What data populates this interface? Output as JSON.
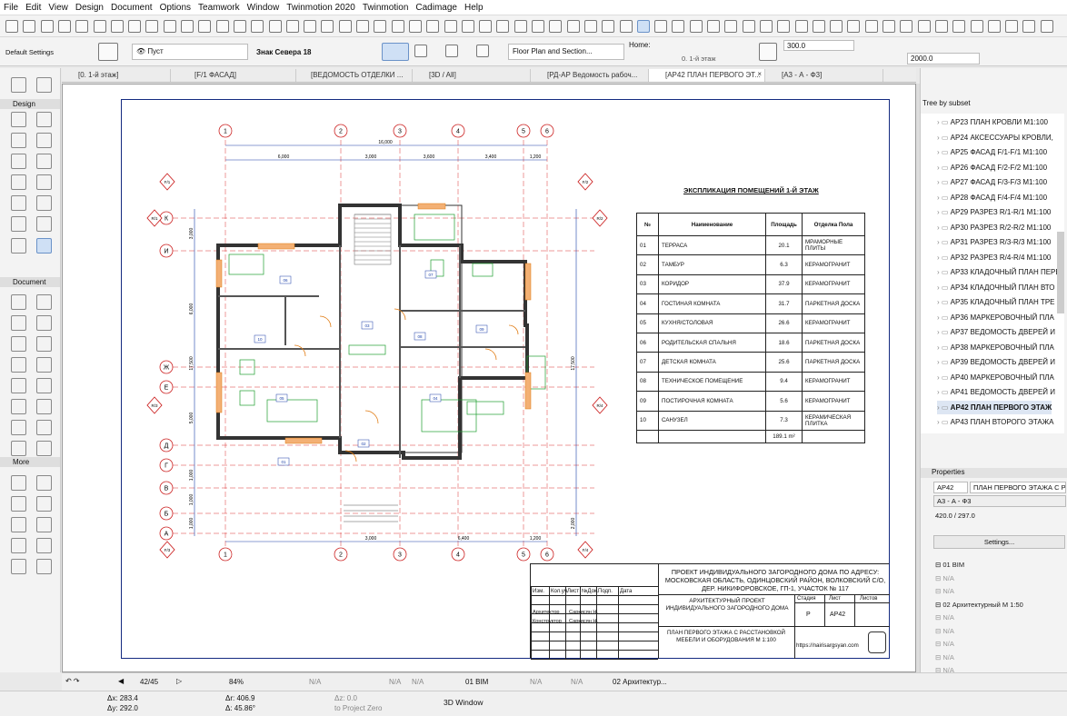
{
  "menu": [
    "File",
    "Edit",
    "View",
    "Design",
    "Document",
    "Options",
    "Teamwork",
    "Window",
    "Twinmotion 2020",
    "Twinmotion",
    "Cadimage",
    "Help"
  ],
  "info_box": {
    "settings": "Default Settings",
    "layer": "Пуст",
    "marker": "Знак Севера 18",
    "view_type": "Floor Plan and Section...",
    "home_label": "Home:",
    "home_story": "0. 1-й этаж",
    "val1": "300.0",
    "val2": "2000.0"
  },
  "tabs": [
    {
      "label": "[0. 1-й этаж]"
    },
    {
      "label": "[F/1 ФАСАД]"
    },
    {
      "label": "[ВЕДОМОСТЬ ОТДЕЛКИ ..."
    },
    {
      "label": "[3D / All]"
    },
    {
      "label": "[РД-АР Ведомость рабоч..."
    },
    {
      "label": "[АР42 ПЛАН ПЕРВОГО ЭТ..."
    },
    {
      "label": "[А3 - А - Ф3]"
    }
  ],
  "toolbox": {
    "design": "Design",
    "document": "Document",
    "more": "More"
  },
  "tree": {
    "title": "Tree by subset",
    "items": [
      "АР23 ПЛАН КРОВЛИ М1:100",
      "АР24 АКСЕССУАРЫ КРОВЛИ,",
      "АР25 ФАСАД F/1-F/1 М1:100",
      "АР26 ФАСАД F/2-F/2 М1:100",
      "АР27 ФАСАД F/3-F/3 М1:100",
      "АР28 ФАСАД F/4-F/4 М1:100",
      "АР29 РАЗРЕЗ R/1-R/1 М1:100",
      "АР30 РАЗРЕЗ R/2-R/2 М1:100",
      "АР31 РАЗРЕЗ R/3-R/3 М1:100",
      "АР32 РАЗРЕЗ R/4-R/4 М1:100",
      "АР33 КЛАДОЧНЫЙ ПЛАН ПЕРВ",
      "АР34 КЛАДОЧНЫЙ ПЛАН ВТО",
      "АР35 КЛАДОЧНЫЙ ПЛАН ТРЕ",
      "АР36 МАРКЕРОВОЧНЫЙ ПЛА",
      "АР37 ВЕДОМОСТЬ ДВЕРЕЙ И",
      "АР38 МАРКЕРОВОЧНЫЙ ПЛА",
      "АР39 ВЕДОМОСТЬ ДВЕРЕЙ И",
      "АР40 МАРКЕРОВОЧНЫЙ ПЛА",
      "АР41 ВЕДОМОСТЬ ДВЕРЕЙ И",
      "АР42 ПЛАН ПЕРВОГО ЭТАЖ",
      "АР43 ПЛАН ВТОРОГО ЭТАЖА"
    ]
  },
  "properties": {
    "title": "Properties",
    "id": "АР42",
    "name": "ПЛАН ПЕРВОГО ЭТАЖА С РАС",
    "master": "А3 - А - Ф3",
    "size": "420.0 / 297.0",
    "settings_btn": "Settings...",
    "rows": [
      "01 BIM",
      "N/A",
      "N/A",
      "02 Архитектурный М 1:50",
      "N/A",
      "N/A",
      "N/A",
      "N/A",
      "N/A",
      "N/A",
      "84%",
      "N/A"
    ]
  },
  "schedule": {
    "title": "ЭКСПЛИКАЦИЯ ПОМЕЩЕНИЙ 1-Й ЭТАЖ",
    "headers": [
      "№",
      "Наименование",
      "Площадь",
      "Отделка Пола"
    ],
    "rows": [
      [
        "01",
        "ТЕРРАСА",
        "20.1",
        "МРАМОРНЫЕ ПЛИТЫ"
      ],
      [
        "02",
        "ТАМБУР",
        "6.3",
        "КЕРАМОГРАНИТ"
      ],
      [
        "03",
        "КОРИДОР",
        "37.9",
        "КЕРАМОГРАНИТ"
      ],
      [
        "04",
        "ГОСТИНАЯ КОМНАТА",
        "31.7",
        "ПАРКЕТНАЯ ДОСКА"
      ],
      [
        "05",
        "КУХНЯ/СТОЛОВАЯ",
        "26.6",
        "КЕРАМОГРАНИТ"
      ],
      [
        "06",
        "РОДИТЕЛЬСКАЯ СПАЛЬНЯ",
        "18.6",
        "ПАРКЕТНАЯ ДОСКА"
      ],
      [
        "07",
        "ДЕТСКАЯ КОМНАТА",
        "25.6",
        "ПАРКЕТНАЯ ДОСКА"
      ],
      [
        "08",
        "ТЕХНИЧЕСКОЕ ПОМЕЩЕНИЕ",
        "9.4",
        "КЕРАМОГРАНИТ"
      ],
      [
        "09",
        "ПОСТИРОЧНАЯ КОМНАТА",
        "5.6",
        "КЕРАМОГРАНИТ"
      ],
      [
        "10",
        "САНУЗЕЛ",
        "7.3",
        "КЕРАМИЧЕСКАЯ ПЛИТКА"
      ]
    ],
    "total": "189.1 m²"
  },
  "stamp": {
    "project": "ПРОЕКТ ИНДИВИДУАЛЬНОГО ЗАГОРОДНОГО ДОМА ПО АДРЕСУ: МОСКОВСКАЯ ОБЛАСТЬ, ОДИНЦОВСКИЙ РАЙОН, ВОЛКОВСКИЙ С/О, ДЕР. НИКИФОРОВСКОЕ, ГП-1, УЧАСТОК № 117",
    "cols": [
      "Изм.",
      "Кол.уч.",
      "Лист",
      "№Док.",
      "Подп.",
      "Дата"
    ],
    "architect_role": "Архитектор",
    "architect": "Саркисян Н.",
    "constructor_role": "Конструктор",
    "constructor": "Саркисян Н.",
    "title": "АРХИТЕКТУРНЫЙ ПРОЕКТ ИНДИВИДУАЛЬНОГО ЗАГОРОДНОГО ДОМА",
    "stage_h": "Стадия",
    "sheet_h": "Лист",
    "sheets_h": "Листов",
    "stage": "Р",
    "sheet": "АР42",
    "drawing": "ПЛАН ПЕРВОГО ЭТАЖА С РАССТАНОВКОЙ МЕБЕЛИ И ОБОРУДОВАНИЯ М 1:100",
    "url": "https://nairisargsyan.com"
  },
  "plan": {
    "axes_top": [
      "1",
      "2",
      "3",
      "4",
      "5",
      "6"
    ],
    "axes_left": [
      "К",
      "И",
      "Ж",
      "Е",
      "Д",
      "Г",
      "В",
      "Б",
      "А"
    ],
    "dims_top": [
      "16,000",
      "6,000",
      "3,000",
      "3,600",
      "3,400",
      "1,200"
    ],
    "dims_bottom": [
      "3,000",
      "6,400",
      "1,200"
    ],
    "dims_left": [
      "3,000",
      "6,000",
      "17,500",
      "5,000",
      "1,000",
      "1,000",
      "1,000"
    ],
    "dims_right": [
      "17,500",
      "2,000"
    ],
    "rooms": [
      "01",
      "02",
      "03",
      "04",
      "05",
      "06",
      "07",
      "08",
      "09",
      "10"
    ],
    "sections": [
      "F/1",
      "F/2",
      "F/3",
      "F/4",
      "R/1",
      "R/2",
      "R/3",
      "R/4"
    ]
  },
  "status": {
    "page": "42/45",
    "zoom": "84%",
    "na1": "N/A",
    "na2": "N/A",
    "na3": "N/A",
    "layer": "01 BIM",
    "penset": "N/A",
    "mvo": "N/A",
    "set": "02 Архитектур..."
  },
  "coords": {
    "dx": "Δx: 283.4",
    "dy": "Δy: 292.0",
    "dr": "Δr: 406.9",
    "da": "Δ: 45.86°",
    "dz": "Δz: 0.0",
    "ref": "to Project Zero",
    "view3d": "3D Window"
  }
}
